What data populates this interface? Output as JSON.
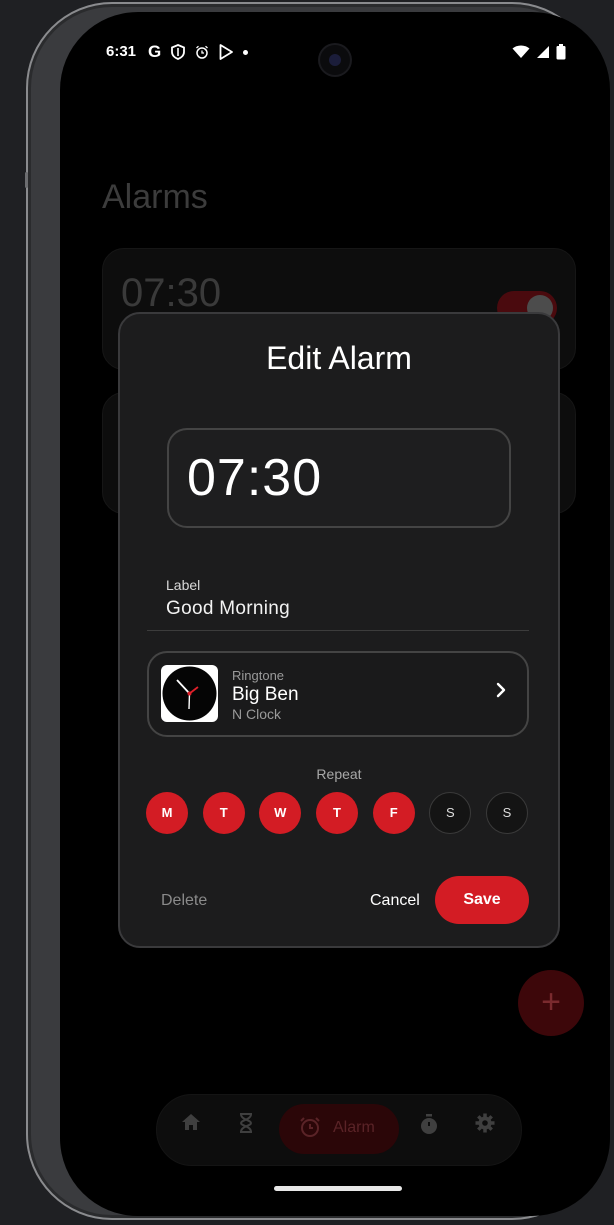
{
  "status_bar": {
    "time": "6:31",
    "left_icons": [
      "google-icon",
      "shield-icon",
      "alarm-icon",
      "play-store-icon",
      "dot-icon"
    ],
    "right_icons": [
      "wifi-icon",
      "signal-icon",
      "battery-icon"
    ]
  },
  "background": {
    "title": "Alarms",
    "alarm_cards": [
      {
        "time": "07:30",
        "enabled": true
      },
      {
        "time": ""
      }
    ],
    "fab_icon": "plus-icon",
    "nav": {
      "items": [
        "home-icon",
        "hourglass-icon",
        "alarm-icon",
        "stopwatch-icon",
        "gear-icon"
      ],
      "active_label": "Alarm"
    }
  },
  "dialog": {
    "title": "Edit Alarm",
    "time": "07:30",
    "label_caption": "Label",
    "label_value": "Good Morning",
    "ringtone": {
      "caption": "Ringtone",
      "name": "Big Ben",
      "source": "N Clock"
    },
    "repeat_caption": "Repeat",
    "days": [
      {
        "letter": "M",
        "selected": true
      },
      {
        "letter": "T",
        "selected": true
      },
      {
        "letter": "W",
        "selected": true
      },
      {
        "letter": "T",
        "selected": true
      },
      {
        "letter": "F",
        "selected": true
      },
      {
        "letter": "S",
        "selected": false
      },
      {
        "letter": "S",
        "selected": false
      }
    ],
    "delete_label": "Delete",
    "cancel_label": "Cancel",
    "save_label": "Save"
  },
  "colors": {
    "accent": "#d31c24",
    "dialog_bg": "#1c1c1d",
    "screen_bg": "#000000"
  }
}
